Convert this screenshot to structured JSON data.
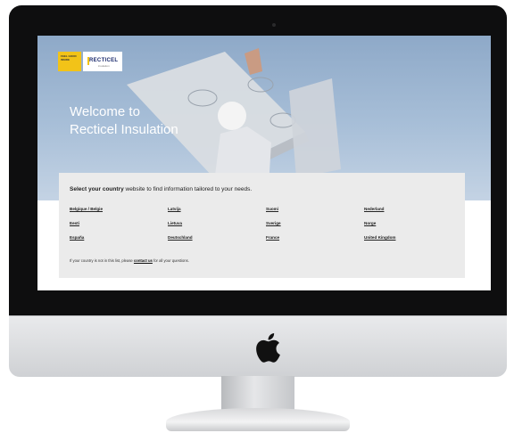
{
  "hero": {
    "welcome_line1": "Welcome to",
    "welcome_line2": "Recticel Insulation"
  },
  "logo": {
    "left_text": "FEEL GOOD INSIDE",
    "brand": "RECTICEL",
    "sub": "insulation"
  },
  "panel": {
    "title_bold": "Select your country",
    "title_rest": "website to find information tailored to your needs.",
    "countries": [
      [
        "Belgique / Belgie",
        "Eesti",
        "España"
      ],
      [
        "Latvija",
        "Lietuva",
        "Deutschland"
      ],
      [
        "Suomi",
        "Sverige",
        "France"
      ],
      [
        "Nederland",
        "Norge",
        "United Kingdom"
      ]
    ],
    "note_prefix": "If your country is not in this list, please",
    "note_link": "contact us",
    "note_suffix": "for all your questions."
  },
  "colors": {
    "logo_yellow": "#f2c318",
    "panel_bg": "#ebebeb",
    "sky": "#a8bfd8"
  }
}
